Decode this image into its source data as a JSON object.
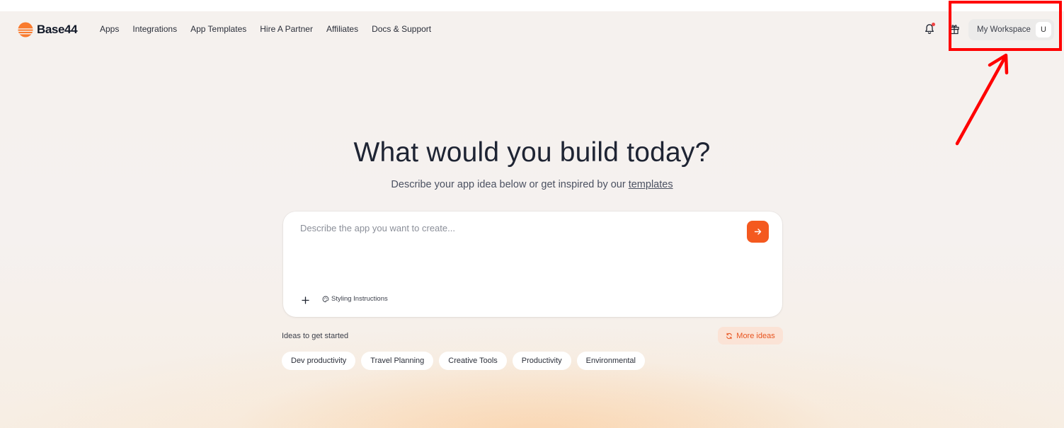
{
  "app": {
    "logo_text": "Base44"
  },
  "nav": {
    "items": [
      {
        "label": "Apps"
      },
      {
        "label": "Integrations"
      },
      {
        "label": "App Templates"
      },
      {
        "label": "Hire A Partner"
      },
      {
        "label": "Affiliates"
      },
      {
        "label": "Docs & Support"
      }
    ]
  },
  "toolbar": {
    "workspace_label": "My Workspace",
    "avatar_initial": "U",
    "notification_icon": "bell-icon",
    "gift_icon": "gift-icon"
  },
  "hero": {
    "title": "What would you build today?",
    "subtitle_prefix": "Describe your app idea below or get inspired by our ",
    "subtitle_link": "templates"
  },
  "prompt": {
    "placeholder": "Describe the app you want to create...",
    "value": "",
    "styling_label": "Styling Instructions"
  },
  "ideas": {
    "label": "Ideas to get started",
    "more_label": "More ideas",
    "chips": [
      {
        "label": "Dev productivity"
      },
      {
        "label": "Travel Planning"
      },
      {
        "label": "Creative Tools"
      },
      {
        "label": "Productivity"
      },
      {
        "label": "Environmental"
      }
    ]
  },
  "colors": {
    "accent": "#f4591f",
    "annotation": "#ff0000"
  }
}
